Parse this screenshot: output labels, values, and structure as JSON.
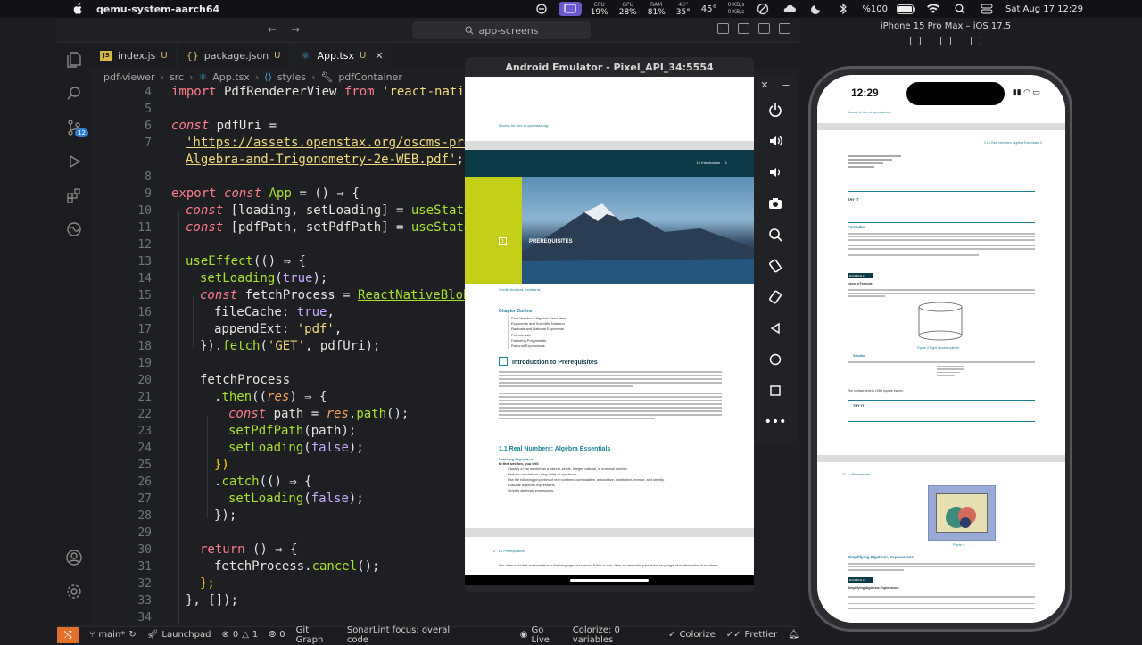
{
  "menubar": {
    "app_name": "qemu-system-aarch64",
    "stats": [
      {
        "label": "CPU",
        "value": "19%"
      },
      {
        "label": "GPU",
        "value": "28%"
      },
      {
        "label": "RAM",
        "value": "81%"
      },
      {
        "label": "45°",
        "value": "35°"
      }
    ],
    "temp": "45°",
    "net_up": "0 KB/s",
    "net_down": "0 KB/s",
    "battery": "%100",
    "datetime": "Sat Aug 17  12:29"
  },
  "vscode": {
    "search_label": "app-screens",
    "tabs": [
      {
        "label": "index.js",
        "mod": "U",
        "icon": "JS"
      },
      {
        "label": "package.json",
        "mod": "U",
        "icon": "{}"
      },
      {
        "label": "App.tsx",
        "mod": "U",
        "icon": "TS"
      }
    ],
    "breadcrumb": [
      "pdf-viewer",
      "src",
      "App.tsx",
      "styles",
      "pdfContainer"
    ],
    "line_numbers": [
      "4",
      "5",
      "6",
      "7",
      "8",
      "9",
      "10",
      "11",
      "12",
      "13",
      "14",
      "15",
      "16",
      "17",
      "18",
      "19",
      "20",
      "21",
      "22",
      "23",
      "24",
      "25",
      "26",
      "27",
      "28",
      "29",
      "30",
      "31",
      "32",
      "33",
      "34"
    ],
    "code": {
      "l4_import": "import",
      "l4_name": " PdfRendererView ",
      "l4_from": "from",
      "l4_str": " 'react-native-pdf",
      "l6_const": "const",
      "l6_rest": " pdfUri =",
      "l7_str": "'https://assets.openstax.org/oscms-prodcms/",
      "l8_str": "Algebra-and-Trigonometry-2e-WEB.pdf'",
      "l8_end": ";",
      "l9_export": "export",
      "l9_const": "const",
      "l9_app": "App",
      "l9_rest": " = () ⇒ {",
      "l10_const": "const",
      "l10_a": " [loading, setLoading] = ",
      "l10_fn": "useState",
      "l10_b": "(",
      "l10_bool": "true",
      "l11_const": "const",
      "l11_a": " [pdfPath, setPdfPath] = ",
      "l11_fn": "useState",
      "l11_b": "(",
      "l11_str": "''",
      "l11_c": ");",
      "l13_fn": "useEffect",
      "l13_rest": "(() ⇒ {",
      "l14_fn": "setLoading",
      "l14_a": "(",
      "l14_bool": "true",
      "l14_b": ");",
      "l15_const": "const",
      "l15_a": " fetchProcess = ",
      "l15_cls": "ReactNativeBlobUtil",
      "l15_b": ".",
      "l16_a": "fileCache: ",
      "l16_bool": "true",
      "l16_b": ",",
      "l17_a": "appendExt: ",
      "l17_str": "'pdf'",
      "l17_b": ",",
      "l18_a": "}).",
      "l18_fn": "fetch",
      "l18_b": "(",
      "l18_str": "'GET'",
      "l18_c": ", pdfUri);",
      "l20_a": "fetchProcess",
      "l21_a": ".",
      "l21_fn": "then",
      "l21_b": "((",
      "l21_prm": "res",
      "l21_c": ") ⇒ {",
      "l22_const": "const",
      "l22_a": " path = ",
      "l22_prm": "res",
      "l22_b": ".",
      "l22_fn": "path",
      "l22_c": "();",
      "l23_fn": "setPdfPath",
      "l23_a": "(path);",
      "l24_fn": "setLoading",
      "l24_a": "(",
      "l24_bool": "false",
      "l24_b": ");",
      "l25_a": "})",
      "l26_a": ".",
      "l26_fn": "catch",
      "l26_b": "(() ⇒ {",
      "l27_fn": "setLoading",
      "l27_a": "(",
      "l27_bool": "false",
      "l27_b": ");",
      "l28_a": "});",
      "l30_kw": "return",
      "l30_a": " () ⇒ {",
      "l31_a": "fetchProcess.",
      "l31_fn": "cancel",
      "l31_b": "();",
      "l32_a": "};",
      "l33_a": "}, []);"
    },
    "status": {
      "branch": "main*",
      "launchpad": "Launchpad",
      "errors": "0",
      "warnings": "1",
      "ports": "0",
      "git_graph": "Git Graph",
      "sonar": "SonarLint focus: overall code",
      "go_live": "Go Live",
      "colorize_vars": "Colorize: 0 variables",
      "colorize": "Colorize",
      "prettier": "Prettier"
    }
  },
  "android": {
    "title": "Android Emulator - Pixel_API_34:5554",
    "page": {
      "header_link": "Access for free at openstax.org",
      "chapter_label": "1 • Introduction",
      "chapter_page": "1",
      "hero_number": "1",
      "hero_title": "PREREQUISITES",
      "credit": "Credit: Andreas Kambanis",
      "outline_title": "Chapter Outline",
      "outline_items": [
        "Real Numbers: Algebra Essentials",
        "Exponents and Scientific Notation",
        "Radicals and Rational Exponents",
        "Polynomials",
        "Factoring Polynomials",
        "Rational Expressions"
      ],
      "intro_title": "Introduction to Prerequisites",
      "section_title": "1.1 Real Numbers: Algebra Essentials",
      "objectives_title": "Learning Objectives",
      "objectives_lead": "In this section, you will:",
      "objectives": [
        "Classify a real number as a natural, whole, integer, rational, or irrational number.",
        "Perform calculations using order of operations.",
        "Use the following properties of real numbers: commutative, associative, distributive, inverse, and identity.",
        "Evaluate algebraic expressions.",
        "Simplify algebraic expressions."
      ],
      "footer_page": "2",
      "footer_label": "1 • Prerequisites",
      "bottom_text": "It is often said that mathematics is the language of science. If this is true, then an essential part of the language of mathematics is numbers."
    }
  },
  "iphone": {
    "title": "iPhone 15 Pro Max – iOS 17.5",
    "time": "12:29",
    "page": {
      "header_link": "Access for free at openstax.org",
      "section_ref": "1.1 • Real Numbers: Algebra Essentials",
      "page_num": "3",
      "try_it": "TRY IT",
      "formulas_title": "Formulas",
      "example_11": "EXAMPLE 11",
      "using_formula": "Using a Formula",
      "figure3": "Figure 3   Right circular cylinder",
      "solution": "Solution",
      "surface_area": "The surface area is 198π square inches.",
      "page2_label": "1 • Prerequisites",
      "page2_num": "10",
      "figure4": "Figure 4",
      "simplify_title": "Simplifying Algebraic Expressions",
      "example_12": "EXAMPLE 12",
      "simplify_sub": "Simplifying Algebraic Expressions"
    }
  }
}
